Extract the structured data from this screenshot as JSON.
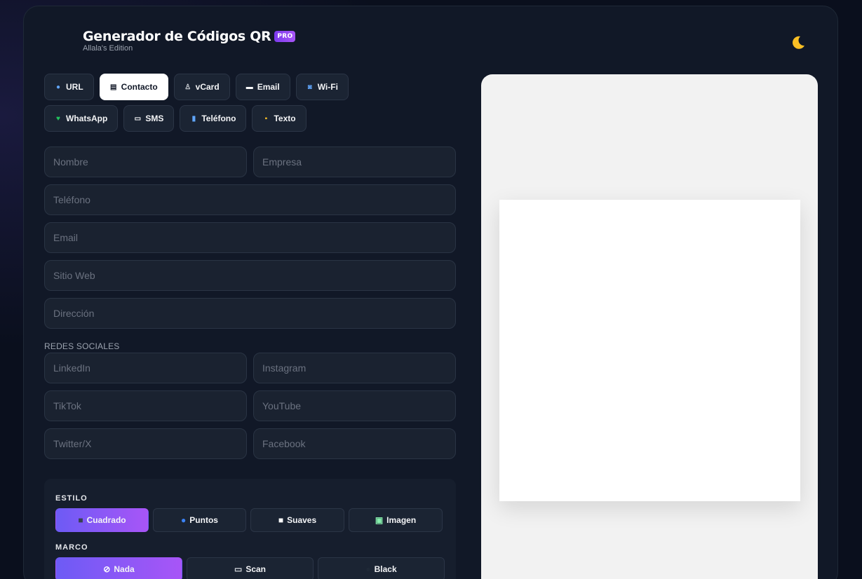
{
  "header": {
    "title": "Generador de Códigos QR",
    "badge": "PRO",
    "subtitle": "Allala's Edition"
  },
  "tabs": [
    [
      {
        "label": "URL",
        "icon": "globe-icon",
        "glyph": "●",
        "color": "#60a5fa"
      },
      {
        "label": "Contacto",
        "icon": "contact-card-icon",
        "glyph": "▤",
        "color": "#111827",
        "active": true
      },
      {
        "label": "vCard",
        "icon": "person-icon",
        "glyph": "♙",
        "color": "#d1d5db"
      },
      {
        "label": "Email",
        "icon": "envelope-icon",
        "glyph": "▬",
        "color": "#f9fafb"
      },
      {
        "label": "Wi-Fi",
        "icon": "wifi-icon",
        "glyph": "◙",
        "color": "#60a5fa"
      }
    ],
    [
      {
        "label": "WhatsApp",
        "icon": "green-heart-icon",
        "glyph": "♥",
        "color": "#22c55e"
      },
      {
        "label": "SMS",
        "icon": "message-icon",
        "glyph": "▭",
        "color": "#f9fafb"
      },
      {
        "label": "Teléfono",
        "icon": "phone-icon",
        "glyph": "▮",
        "color": "#60a5fa"
      },
      {
        "label": "Texto",
        "icon": "memo-icon",
        "glyph": "▪",
        "color": "#fbbf24"
      }
    ]
  ],
  "fields": {
    "nombre": "Nombre",
    "empresa": "Empresa",
    "telefono": "Teléfono",
    "email": "Email",
    "sitio_web": "Sitio Web",
    "direccion": "Dirección",
    "redes_label": "REDES SOCIALES",
    "linkedin": "LinkedIn",
    "instagram": "Instagram",
    "tiktok": "TikTok",
    "youtube": "YouTube",
    "twitter": "Twitter/X",
    "facebook": "Facebook"
  },
  "estilo": {
    "label": "ESTILO",
    "options": [
      {
        "label": "Cuadrado",
        "icon": "black-square-icon",
        "glyph": "■",
        "color": "#374151",
        "active": true
      },
      {
        "label": "Puntos",
        "icon": "blue-circle-icon",
        "glyph": "●",
        "color": "#3b82f6"
      },
      {
        "label": "Suaves",
        "icon": "white-square-icon",
        "glyph": "■",
        "color": "#ffffff"
      },
      {
        "label": "Imagen",
        "icon": "picture-icon",
        "glyph": "▣",
        "color": "#86efac"
      }
    ]
  },
  "marco": {
    "label": "MARCO",
    "options": [
      {
        "label": "Nada",
        "icon": "prohibited-icon",
        "glyph": "⊘",
        "color": "#ffffff",
        "active": true
      },
      {
        "label": "Scan",
        "icon": "camera-icon",
        "glyph": "▭",
        "color": "#d1d5db"
      },
      {
        "label": "Black",
        "icon": "black-circle-icon",
        "glyph": "●",
        "color": "#1f2937"
      }
    ]
  }
}
